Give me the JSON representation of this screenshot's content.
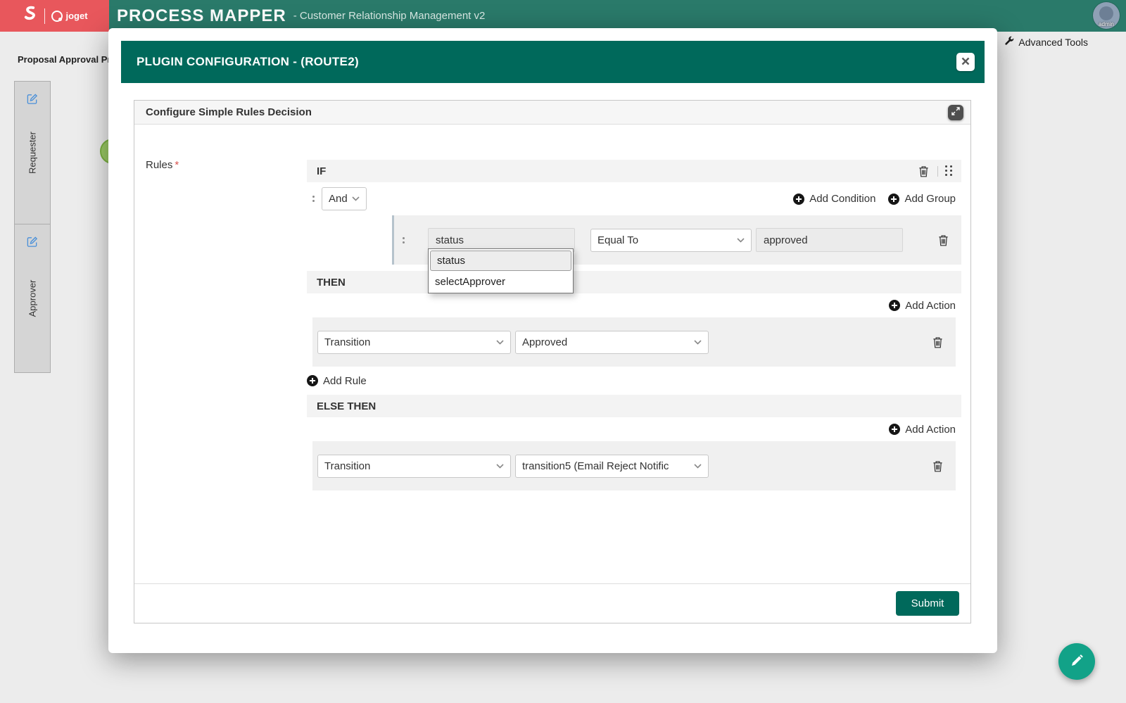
{
  "topbar": {
    "brand": "joget",
    "title": "PROCESS MAPPER",
    "subtitle": "- Customer Relationship Management v2",
    "user": "admin"
  },
  "page": {
    "tab": "Proposal Approval Pr",
    "advanced_tools": "Advanced Tools",
    "lanes": [
      {
        "label": "Requester"
      },
      {
        "label": "Approver"
      }
    ]
  },
  "modal": {
    "title": "PLUGIN CONFIGURATION - (ROUTE2)",
    "panel_title": "Configure Simple Rules Decision",
    "rules": {
      "label": "Rules",
      "required": "*",
      "if_label": "IF",
      "join_operator": "And",
      "add_condition": "Add Condition",
      "add_group": "Add Group",
      "condition": {
        "field": "status",
        "operator": "Equal To",
        "value": "approved"
      },
      "field_dropdown": {
        "options": [
          {
            "label": "status"
          },
          {
            "label": "selectApprover"
          }
        ]
      },
      "then_label": "THEN",
      "then_add_action": "Add Action",
      "then_action": {
        "type": "Transition",
        "target": "Approved"
      },
      "add_rule": "Add Rule",
      "else_label": "ELSE THEN",
      "else_add_action": "Add Action",
      "else_action": {
        "type": "Transition",
        "target": "transition5 (Email Reject Notific"
      }
    },
    "submit": "Submit"
  },
  "colors": {
    "topbar_green": "#2a7a6a",
    "brand_red": "#e8575c",
    "header_green": "#00695b",
    "accent_teal": "#12a288",
    "required_red": "#d9534f"
  }
}
